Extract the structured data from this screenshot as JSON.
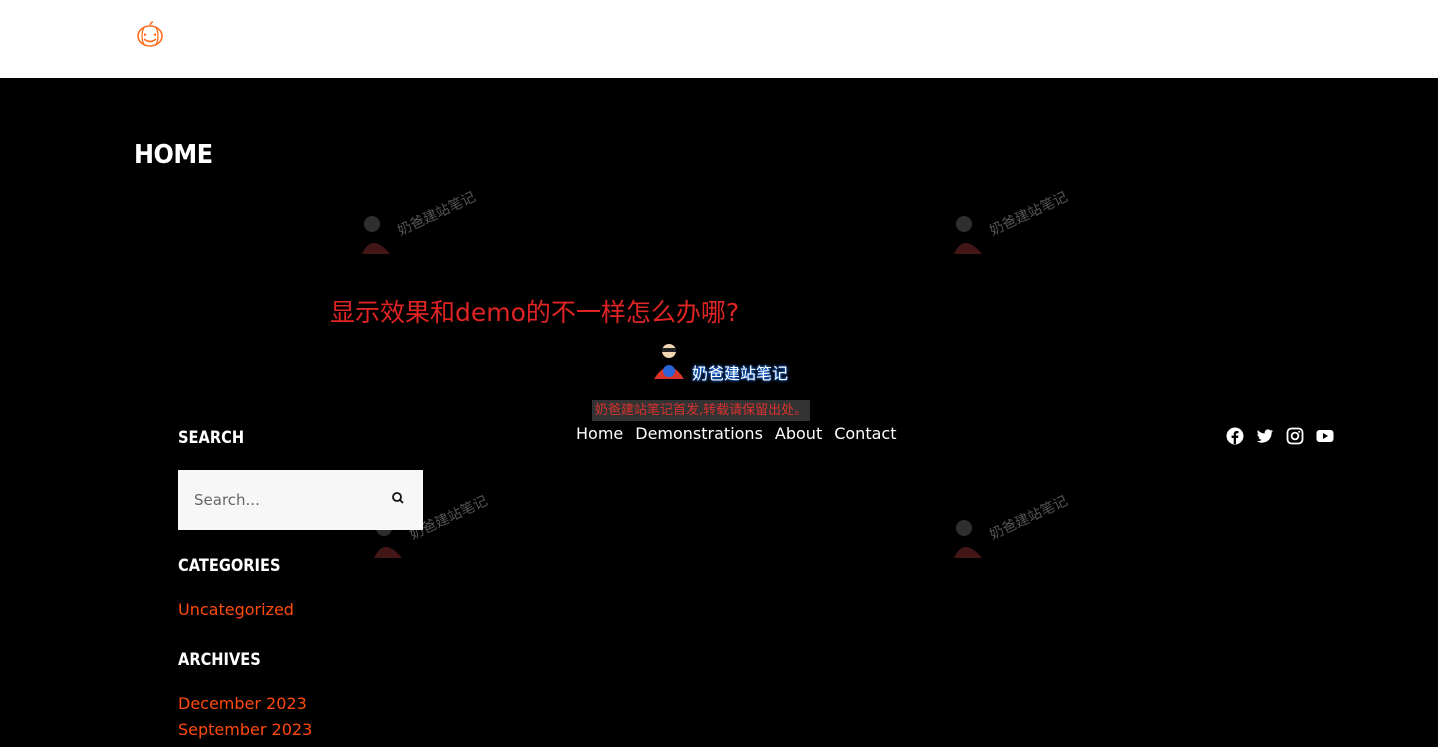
{
  "header": {
    "logo_icon": "pumpkin-icon"
  },
  "page": {
    "title": "Home"
  },
  "overlay": {
    "question": "显示效果和demo的不一样怎么办哪?",
    "brand_text": "奶爸建站笔记",
    "repost_note": "奶爸建站笔记首发,转载请保留出处。",
    "watermark_text": "奶爸建站笔记"
  },
  "nav": {
    "items": [
      {
        "label": "Home"
      },
      {
        "label": "Demonstrations"
      },
      {
        "label": "About"
      },
      {
        "label": "Contact"
      }
    ]
  },
  "social": [
    "facebook-icon",
    "twitter-icon",
    "instagram-icon",
    "youtube-icon"
  ],
  "sidebar": {
    "search": {
      "title": "Search",
      "placeholder": "Search..."
    },
    "categories": {
      "title": "Categories",
      "items": [
        {
          "label": "Uncategorized"
        }
      ]
    },
    "archives": {
      "title": "Archives",
      "items": [
        {
          "label": "December 2023"
        },
        {
          "label": "September 2023"
        }
      ]
    }
  },
  "colors": {
    "accent": "#ff4a0e",
    "question": "#e02424",
    "background": "#000000"
  }
}
